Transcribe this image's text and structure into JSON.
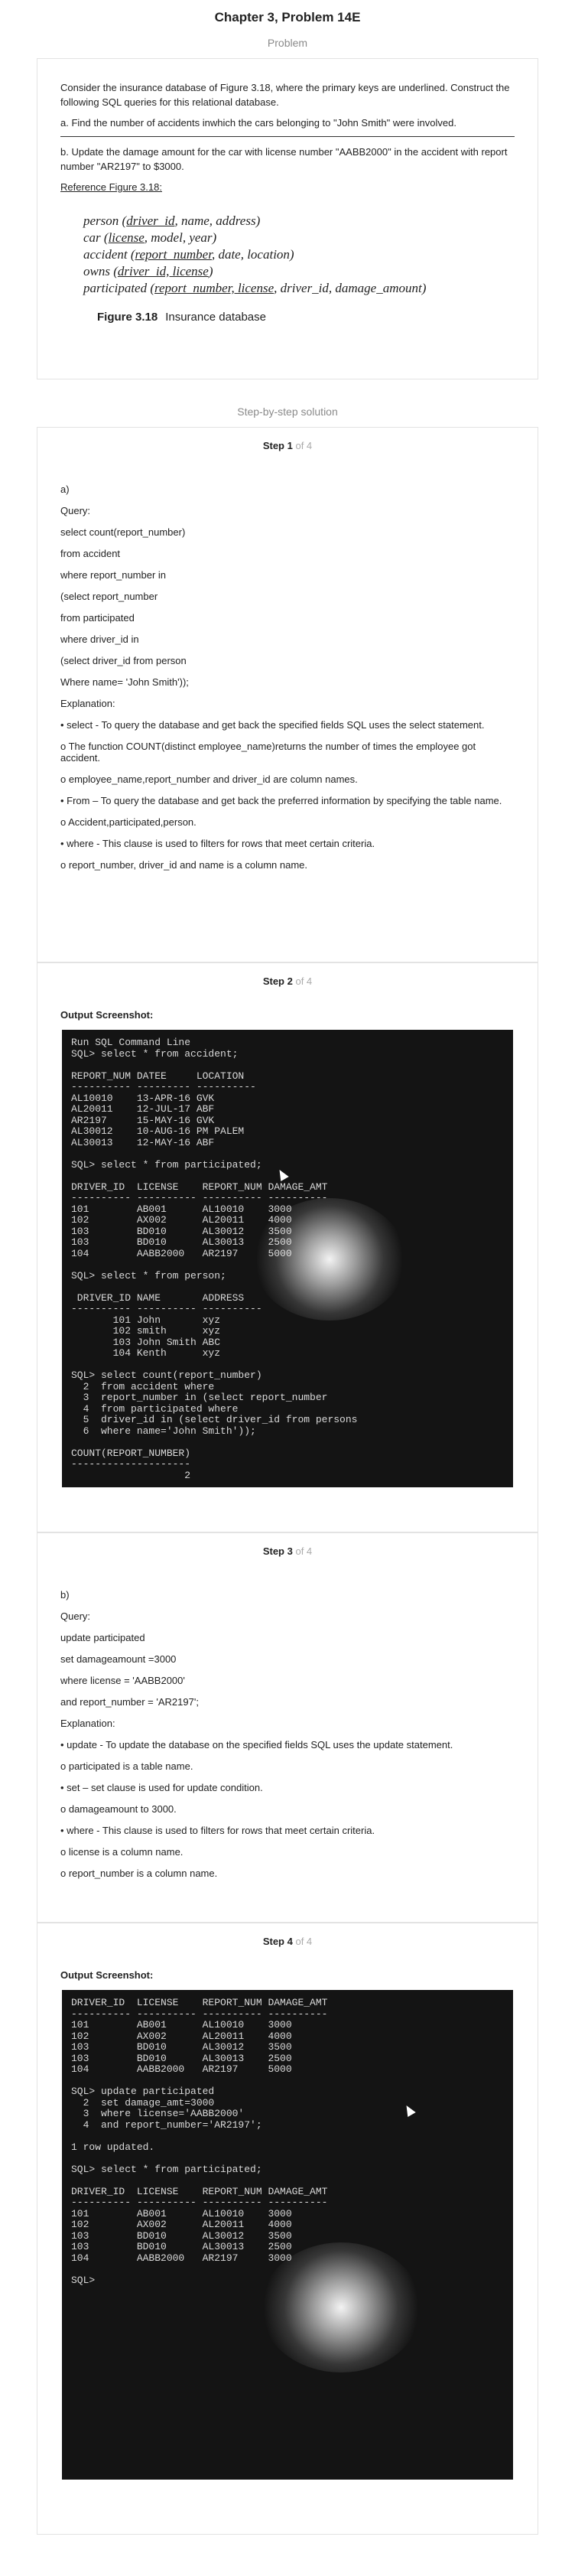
{
  "page": {
    "title": "Chapter 3, Problem 14E",
    "problem_label": "Problem",
    "solution_label": "Step-by-step solution"
  },
  "problem": {
    "p1": "Consider the insurance database of Figure 3.18, where the primary keys are underlined. Construct the following SQL queries for this relational database.",
    "p2": "a. Find the number of accidents inwhich the cars belonging to \"John Smith\" were involved.",
    "p3": "b. Update the damage amount for the car with license number \"AABB2000\" in the accident with report number \"AR2197\" to $3000.",
    "ref": "Reference Figure 3.18:",
    "schema": {
      "person": "person (",
      "person_k": "driver_id",
      "person_r": ", name, address)",
      "car": "car (",
      "car_k": "license",
      "car_r": ", model, year)",
      "accident": "accident (",
      "accident_k": "report_number",
      "accident_r": ", date, location)",
      "owns": "owns (",
      "owns_k": "driver_id, license",
      "owns_r": ")",
      "participated": "participated (",
      "participated_k": "report_number, license",
      "participated_r": ", driver_id, damage_amount)"
    },
    "figure_num": "Figure 3.18",
    "figure_caption": "Insurance database"
  },
  "steps": [
    {
      "label": "Step 1",
      "of": "of 4",
      "lines": [
        "a)",
        "Query:",
        "select count(report_number)",
        "from accident",
        "where report_number in",
        "(select report_number",
        "from participated",
        "where driver_id in",
        "(select driver_id from person",
        "Where name= 'John Smith'));",
        "Explanation:",
        "• select - To query the database and get back the specified fields SQL uses the select statement.",
        "o The function COUNT(distinct employee_name)returns the number of times the employee got accident.",
        "o employee_name,report_number and driver_id are column names.",
        "• From – To query the database and get back the preferred information by specifying the table name.",
        "o Accident,participated,person.",
        "• where - This clause is used to filters for rows that meet certain criteria.",
        "o report_number, driver_id and name is a column name."
      ]
    },
    {
      "label": "Step 2",
      "of": "of 4",
      "heading": "Output Screenshot:",
      "terminal": "Run SQL Command Line\nSQL> select * from accident;\n\nREPORT_NUM DATEE     LOCATION\n---------- --------- ----------\nAL10010    13-APR-16 GVK\nAL20011    12-JUL-17 ABF\nAR2197     15-MAY-16 GVK\nAL30012    10-AUG-16 PM PALEM\nAL30013    12-MAY-16 ABF\n\nSQL> select * from participated;\n\nDRIVER_ID  LICENSE    REPORT_NUM DAMAGE_AMT\n---------- ---------- ---------- ----------\n101        AB001      AL10010    3000\n102        AX002      AL20011    4000\n103        BD010      AL30012    3500\n103        BD010      AL30013    2500\n104        AABB2000   AR2197     5000\n\nSQL> select * from person;\n\n DRIVER_ID NAME       ADDRESS\n---------- ---------- ----------\n       101 John       xyz\n       102 smith      xyz\n       103 John Smith ABC\n       104 Kenth      xyz\n\nSQL> select count(report_number)\n  2  from accident where\n  3  report_number in (select report_number\n  4  from participated where\n  5  driver_id in (select driver_id from persons\n  6  where name='John Smith'));\n\nCOUNT(REPORT_NUMBER)\n--------------------\n                   2\n\nSQL> _"
    },
    {
      "label": "Step 3",
      "of": "of 4",
      "lines": [
        "b)",
        "Query:",
        "update participated",
        "set damageamount =3000",
        "where license = 'AABB2000'",
        "and report_number = 'AR2197';",
        "Explanation:",
        "• update - To update the database on the specified fields SQL uses the update statement.",
        "o participated is a table name.",
        "• set – set clause is used for update condition.",
        "o damageamount to 3000.",
        "• where - This clause is used to filters for rows that meet certain criteria.",
        "o license is a column name.",
        "o report_number is a column name."
      ]
    },
    {
      "label": "Step 4",
      "of": "of 4",
      "heading": "Output Screenshot:",
      "terminal": "DRIVER_ID  LICENSE    REPORT_NUM DAMAGE_AMT\n---------- ---------- ---------- ----------\n101        AB001      AL10010    3000\n102        AX002      AL20011    4000\n103        BD010      AL30012    3500\n103        BD010      AL30013    2500\n104        AABB2000   AR2197     5000\n\nSQL> update participated\n  2  set damage_amt=3000\n  3  where license='AABB2000'\n  4  and report_number='AR2197';\n\n1 row updated.\n\nSQL> select * from participated;\n\nDRIVER_ID  LICENSE    REPORT_NUM DAMAGE_AMT\n---------- ---------- ---------- ----------\n101        AB001      AL10010    3000\n102        AX002      AL20011    4000\n103        BD010      AL30012    3500\n103        BD010      AL30013    2500\n104        AABB2000   AR2197     3000\n\nSQL>"
    }
  ]
}
